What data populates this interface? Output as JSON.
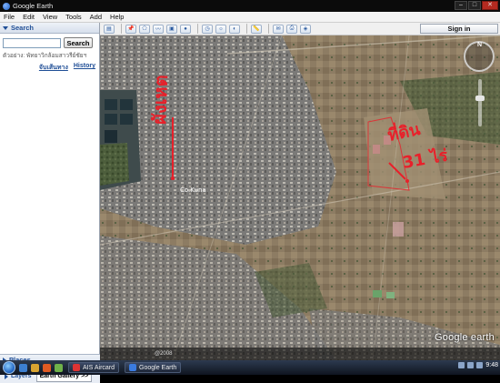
{
  "window": {
    "title": "Google Earth"
  },
  "menu": [
    "File",
    "Edit",
    "View",
    "Tools",
    "Add",
    "Help"
  ],
  "search_panel": {
    "header": "Search",
    "query": "",
    "button_label": "Search",
    "example": "ตัวอย่าง: พัทยาวิกล้อมสาวรีย์ชัยฯ",
    "links": [
      "จับเส้นทาง",
      "History"
    ]
  },
  "places_panel": {
    "header": "Places"
  },
  "bottom_tabs": [
    "Layers",
    "Earth Gallery >>"
  ],
  "toolbar": {
    "sign_in_label": "Sign in"
  },
  "map": {
    "annotation_left": "ผังเหต",
    "annotation_right_line1": "ที่ดิน",
    "annotation_right_line2": "31 ไร่",
    "place_label": "Co.Kuna",
    "watermark": "Google earth",
    "status_text": "@2008",
    "compass_north": "N",
    "annotation_color": "#e8202a"
  },
  "taskbar": {
    "tasks": [
      "AIS Aircard",
      "Google Earth"
    ],
    "clock": "9:48"
  }
}
